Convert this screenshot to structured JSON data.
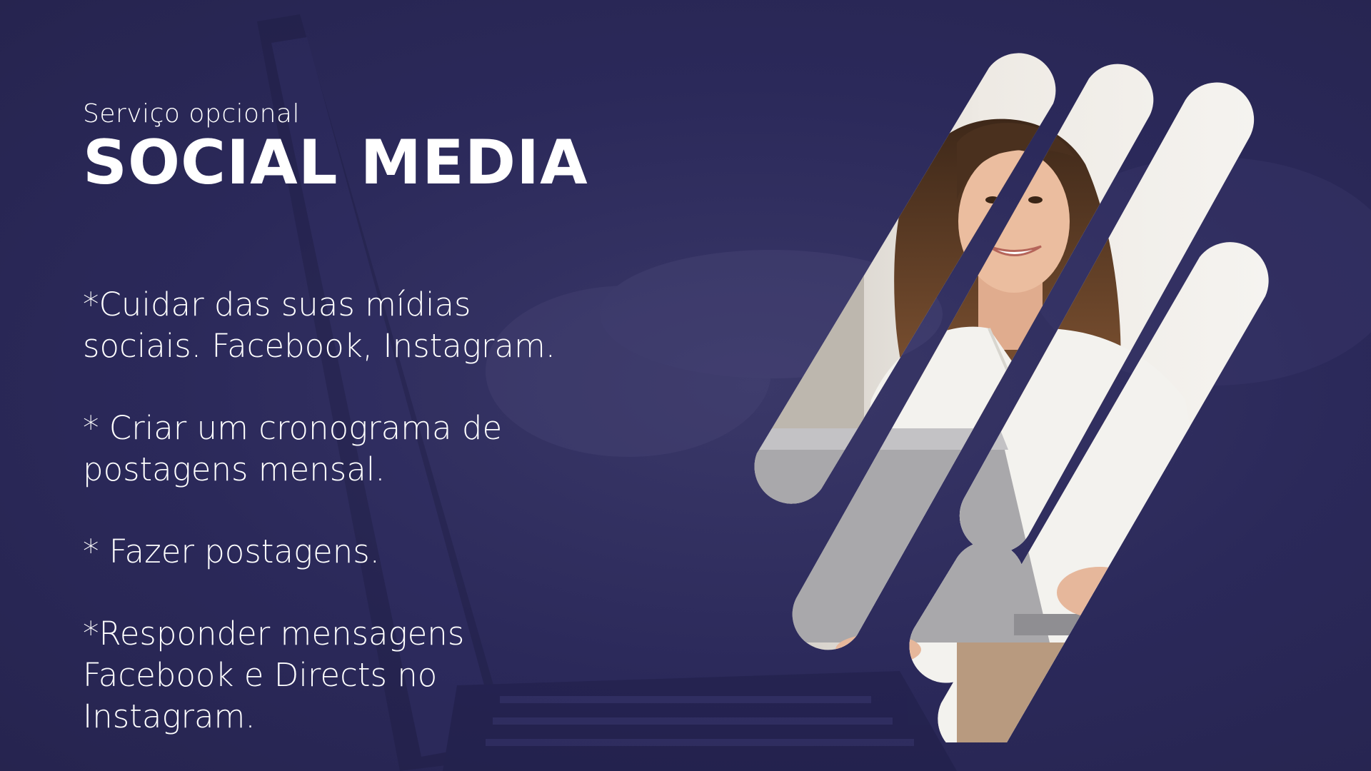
{
  "slide": {
    "subtitle": "Serviço opcional",
    "title": "SOCIAL MEDIA",
    "items": [
      "*Cuidar das suas mídias\nsociais. Facebook, Instagram.",
      "* Criar um cronograma de\npostagens mensal.",
      "* Fazer postagens.",
      "*Responder mensagens\nFacebook e Directs no\nInstagram."
    ]
  },
  "colors": {
    "background": "#2c2a5b",
    "text": "#ffffff",
    "shirt": "#f3f2ee",
    "laptop": "#a9a8ab",
    "hair": "#5a3a25",
    "skin": "#e6b79b"
  }
}
